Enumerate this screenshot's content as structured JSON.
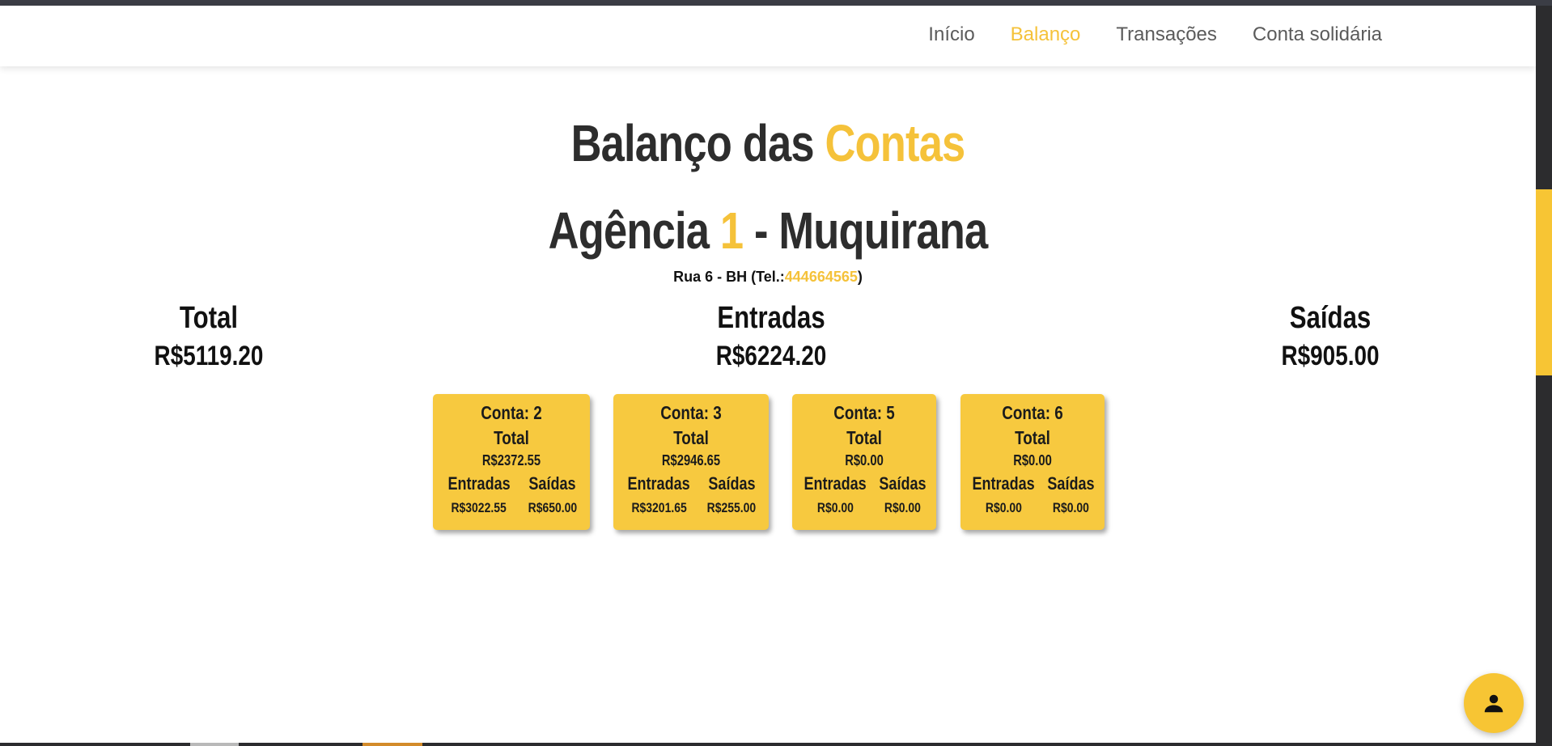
{
  "nav": {
    "items": [
      {
        "label": "Início"
      },
      {
        "label": "Balanço"
      },
      {
        "label": "Transações"
      },
      {
        "label": "Conta solidária"
      }
    ],
    "active_index": 1
  },
  "page": {
    "title_part1": "Balanço das ",
    "title_part2": "Contas",
    "agency_prefix": "Agência ",
    "agency_number": "1",
    "agency_suffix": " - Muquirana",
    "address_prefix": "Rua 6 - BH (Tel.:",
    "phone": "444664565",
    "address_suffix": ")"
  },
  "summary": {
    "total": {
      "label": "Total",
      "value": "R$5119.20"
    },
    "entradas": {
      "label": "Entradas",
      "value": "R$6224.20"
    },
    "saidas": {
      "label": "Saídas",
      "value": "R$905.00"
    }
  },
  "accounts": [
    {
      "title": "Conta: 2",
      "total_label": "Total",
      "total": "R$2372.55",
      "in_label": "Entradas",
      "in": "R$3022.55",
      "out_label": "Saídas",
      "out": "R$650.00"
    },
    {
      "title": "Conta: 3",
      "total_label": "Total",
      "total": "R$2946.65",
      "in_label": "Entradas",
      "in": "R$3201.65",
      "out_label": "Saídas",
      "out": "R$255.00"
    },
    {
      "title": "Conta: 5",
      "total_label": "Total",
      "total": "R$0.00",
      "in_label": "Entradas",
      "in": "R$0.00",
      "out_label": "Saídas",
      "out": "R$0.00"
    },
    {
      "title": "Conta: 6",
      "total_label": "Total",
      "total": "R$0.00",
      "in_label": "Entradas",
      "in": "R$0.00",
      "out_label": "Saídas",
      "out": "R$0.00"
    }
  ],
  "colors": {
    "accent": "#f5c23a",
    "card": "#f7c93f",
    "dark": "#2d2d2d"
  },
  "icons": {
    "fab": "person-icon"
  }
}
